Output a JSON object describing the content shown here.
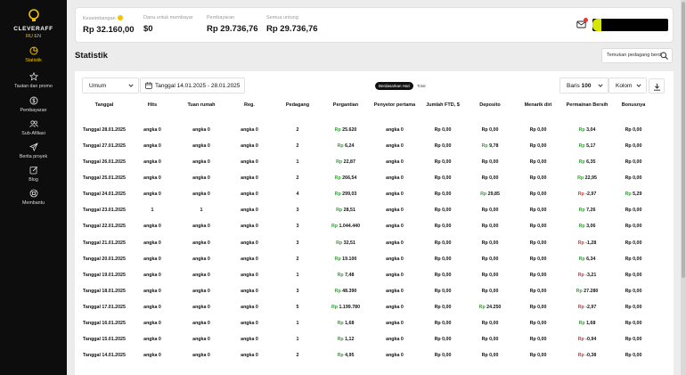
{
  "sidebar": {
    "logo": "CLEVERAFF",
    "lang_ru": "RU",
    "lang_en": "EN",
    "items": [
      {
        "label": "Statistik",
        "icon": "pie-chart-icon",
        "active": true
      },
      {
        "label": "Tautan dan promo",
        "icon": "star-icon"
      },
      {
        "label": "Pembayaran",
        "icon": "dollar-icon"
      },
      {
        "label": "Sub-Afiliasi",
        "icon": "users-icon"
      },
      {
        "label": "Berita proyek",
        "icon": "send-icon"
      },
      {
        "label": "Blog",
        "icon": "edit-icon"
      },
      {
        "label": "Membantu",
        "icon": "help-icon"
      }
    ]
  },
  "summary": [
    {
      "label": "Keseimbangan",
      "value": "Rp 32.160,00",
      "emoji": true
    },
    {
      "label": "Dana untuk membayar",
      "value": "$0"
    },
    {
      "label": "Pembayaran",
      "value": "Rp 29.736,76"
    },
    {
      "label": "Semua untung",
      "value": "Rp 29.736,76"
    }
  ],
  "page_title": "Statistik",
  "find_trader_label": "Temukan pedagang berd",
  "filters": {
    "type_value": "Umum",
    "date_range": "Tanggal 14.01.2025 - 28.01.2025",
    "toggle_active": "Berdasarkan Hari",
    "toggle_other": "Total",
    "rows_label": "Baris",
    "rows_value": "100",
    "columns_label": "Kolom"
  },
  "colors": {
    "accent": "#f2c200",
    "positive": "#3a9b3a",
    "negative": "#d33333",
    "sidebar": "#0d0d0d"
  },
  "table": {
    "headers": [
      "Tanggal",
      "Hits",
      "Tuan rumah",
      "Reg.",
      "Pedagang",
      "Pergantian",
      "Penyetor pertama",
      "Jumlah FTD, $",
      "Deposito",
      "Menarik diri",
      "Permainan Bersih",
      "Bonusnya"
    ],
    "rows": [
      {
        "date": "Tanggal 28.01.2025",
        "hits": "angka 0",
        "hosts": "angka 0",
        "reg": "angka 0",
        "traders": "2",
        "turnover": "25.620",
        "ftd": "angka 0",
        "ftd_sum": "0,00",
        "deposits": "0,00",
        "withdrawals": "0,00",
        "net": "3,04",
        "net_neg": false,
        "bonus": "0,00"
      },
      {
        "date": "Tanggal 27.01.2025",
        "hits": "angka 0",
        "hosts": "angka 0",
        "reg": "angka 0",
        "traders": "2",
        "turnover": "6,24",
        "ftd": "angka 0",
        "ftd_sum": "0,00",
        "deposits": "9,78",
        "withdrawals": "0,00",
        "net": "5,17",
        "net_neg": false,
        "bonus": "0,00"
      },
      {
        "date": "Tanggal 26.01.2025",
        "hits": "angka 0",
        "hosts": "angka 0",
        "reg": "angka 0",
        "traders": "1",
        "turnover": "22,87",
        "ftd": "angka 0",
        "ftd_sum": "0,00",
        "deposits": "0,00",
        "withdrawals": "0,00",
        "net": "6,35",
        "net_neg": false,
        "bonus": "0,00"
      },
      {
        "date": "Tanggal 25.01.2025",
        "hits": "angka 0",
        "hosts": "angka 0",
        "reg": "angka 0",
        "traders": "2",
        "turnover": "266,54",
        "ftd": "angka 0",
        "ftd_sum": "0,00",
        "deposits": "0,00",
        "withdrawals": "0,00",
        "net": "22,95",
        "net_neg": false,
        "bonus": "0,00"
      },
      {
        "date": "Tanggal 24.01.2025",
        "hits": "angka 0",
        "hosts": "angka 0",
        "reg": "angka 0",
        "traders": "4",
        "turnover": "299,03",
        "ftd": "angka 0",
        "ftd_sum": "0,00",
        "deposits": "29,85",
        "withdrawals": "0,00",
        "net": "-2,97",
        "net_neg": true,
        "bonus": "5,29"
      },
      {
        "date": "Tanggal 23.01.2025",
        "hits": "1",
        "hosts": "1",
        "reg": "angka 0",
        "traders": "3",
        "turnover": "28,51",
        "ftd": "angka 0",
        "ftd_sum": "0,00",
        "deposits": "0,00",
        "withdrawals": "0,00",
        "net": "7,26",
        "net_neg": false,
        "bonus": "0,00"
      },
      {
        "date": "Tanggal 22.01.2025",
        "hits": "angka 0",
        "hosts": "angka 0",
        "reg": "angka 0",
        "traders": "3",
        "turnover": "1.044.440",
        "ftd": "angka 0",
        "ftd_sum": "0,00",
        "deposits": "0,00",
        "withdrawals": "0,00",
        "net": "3,06",
        "net_neg": false,
        "bonus": "0,00"
      },
      {
        "date": "Tanggal 21.01.2025",
        "hits": "angka 0",
        "hosts": "angka 0",
        "reg": "angka 0",
        "traders": "3",
        "turnover": "32,51",
        "ftd": "angka 0",
        "ftd_sum": "0,00",
        "deposits": "0,00",
        "withdrawals": "0,00",
        "net": "-1,28",
        "net_neg": true,
        "bonus": "0,00"
      },
      {
        "date": "Tanggal 20.01.2025",
        "hits": "angka 0",
        "hosts": "angka 0",
        "reg": "angka 0",
        "traders": "2",
        "turnover": "19.100",
        "ftd": "angka 0",
        "ftd_sum": "0,00",
        "deposits": "0,00",
        "withdrawals": "0,00",
        "net": "6,34",
        "net_neg": false,
        "bonus": "0,00"
      },
      {
        "date": "Tanggal 19.01.2025",
        "hits": "angka 0",
        "hosts": "angka 0",
        "reg": "angka 0",
        "traders": "1",
        "turnover": "7,48",
        "ftd": "angka 0",
        "ftd_sum": "0,00",
        "deposits": "0,00",
        "withdrawals": "0,00",
        "net": "-3,21",
        "net_neg": true,
        "bonus": "0,00"
      },
      {
        "date": "Tanggal 18.01.2025",
        "hits": "angka 0",
        "hosts": "angka 0",
        "reg": "angka 0",
        "traders": "3",
        "turnover": "48.390",
        "ftd": "angka 0",
        "ftd_sum": "0,00",
        "deposits": "0,00",
        "withdrawals": "0,00",
        "net": "27.280",
        "net_neg": false,
        "bonus": "0,00"
      },
      {
        "date": "Tanggal 17.01.2025",
        "hits": "angka 0",
        "hosts": "angka 0",
        "reg": "angka 0",
        "traders": "5",
        "turnover": "1.199.780",
        "ftd": "angka 0",
        "ftd_sum": "0,00",
        "deposits": "24.250",
        "withdrawals": "0,00",
        "net": "-2,97",
        "net_neg": true,
        "bonus": "0,00"
      },
      {
        "date": "Tanggal 16.01.2025",
        "hits": "angka 0",
        "hosts": "angka 0",
        "reg": "angka 0",
        "traders": "1",
        "turnover": "1,68",
        "ftd": "angka 0",
        "ftd_sum": "0,00",
        "deposits": "0,00",
        "withdrawals": "0,00",
        "net": "1,68",
        "net_neg": false,
        "bonus": "0,00"
      },
      {
        "date": "Tanggal 15.01.2025",
        "hits": "angka 0",
        "hosts": "angka 0",
        "reg": "angka 0",
        "traders": "1",
        "turnover": "1,12",
        "ftd": "angka 0",
        "ftd_sum": "0,00",
        "deposits": "0,00",
        "withdrawals": "0,00",
        "net": "-0,94",
        "net_neg": true,
        "bonus": "0,00"
      },
      {
        "date": "Tanggal 14.01.2025",
        "hits": "angka 0",
        "hosts": "angka 0",
        "reg": "angka 0",
        "traders": "2",
        "turnover": "4,95",
        "ftd": "angka 0",
        "ftd_sum": "0,00",
        "deposits": "0,00",
        "withdrawals": "0,00",
        "net": "-0,38",
        "net_neg": true,
        "bonus": "0,00"
      }
    ]
  }
}
